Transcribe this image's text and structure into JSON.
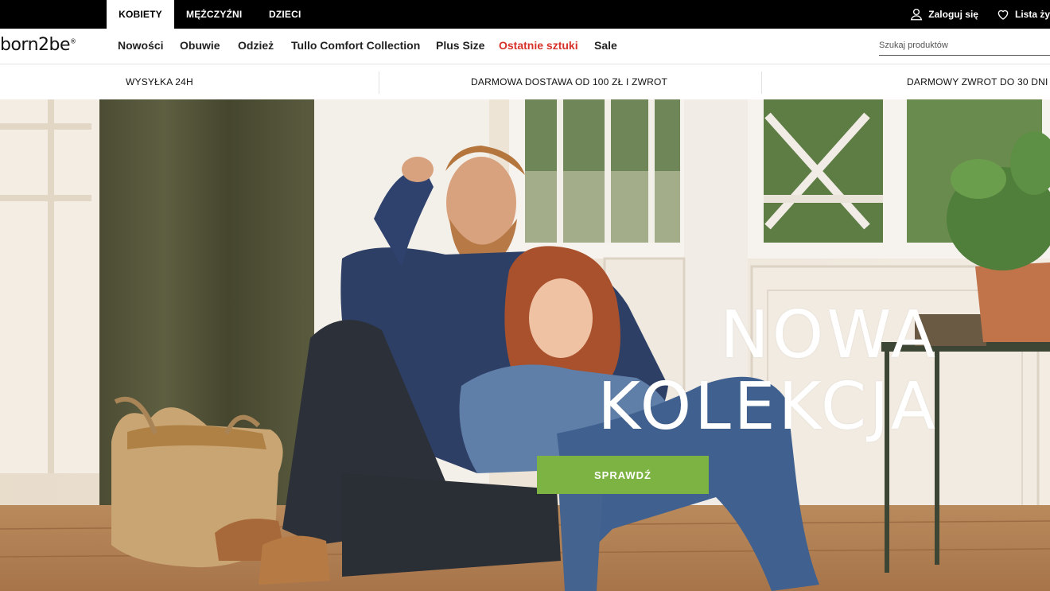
{
  "topbar": {
    "tabs": [
      {
        "label": "KOBIETY",
        "active": true
      },
      {
        "label": "MĘŻCZYŹNI",
        "active": false
      },
      {
        "label": "DZIECI",
        "active": false
      }
    ],
    "login_label": "Zaloguj się",
    "wishlist_label": "Lista ży"
  },
  "brand": {
    "logo_text": "born2be",
    "logo_mark": "®"
  },
  "nav": {
    "items": [
      {
        "label": "Nowości"
      },
      {
        "label": "Obuwie"
      },
      {
        "label": "Odzież"
      },
      {
        "label": "Tullo Comfort Collection"
      },
      {
        "label": "Plus Size"
      },
      {
        "label": "Ostatnie sztuki",
        "highlight": "#d7312b"
      },
      {
        "label": "Sale"
      }
    ],
    "search_placeholder": "Szukaj produktów"
  },
  "infostrip": {
    "items": [
      {
        "label": "WYSYŁKA 24H"
      },
      {
        "label": "DARMOWA DOSTAWA OD 100 ZŁ I ZWROT"
      },
      {
        "label": "DARMOWY ZWROT DO 30 DNI"
      }
    ]
  },
  "hero": {
    "title_line1": "NOWA",
    "title_line2": "KOLEKCJA",
    "cta_label": "SPRAWDŹ",
    "cta_color": "#7cb342"
  }
}
